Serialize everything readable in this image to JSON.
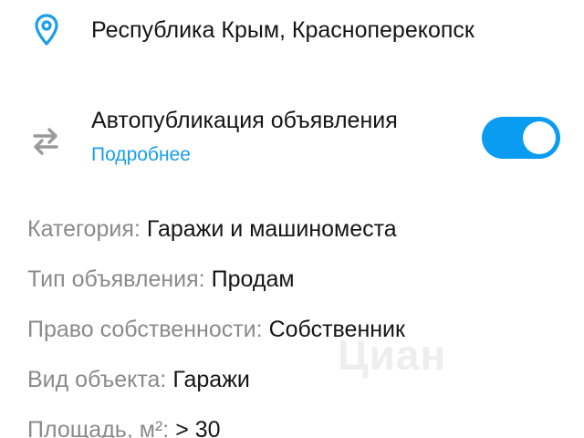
{
  "location": {
    "icon": "location-pin-icon",
    "text": "Республика Крым, Красноперекопск"
  },
  "autopublish": {
    "icon": "swap-arrows-icon",
    "title": "Автопубликация объявления",
    "link": "Подробнее",
    "enabled": true,
    "accent_color": "#0a9cf0"
  },
  "properties": [
    {
      "label": "Категория:",
      "value": "Гаражи и машиноместа"
    },
    {
      "label": "Тип объявления:",
      "value": "Продам"
    },
    {
      "label": "Право собственности:",
      "value": "Собственник"
    },
    {
      "label": "Вид объекта:",
      "value": "Гаражи"
    },
    {
      "label": "Площадь, м²:",
      "value": "> 30"
    }
  ],
  "watermark": {
    "text": "Циан"
  }
}
